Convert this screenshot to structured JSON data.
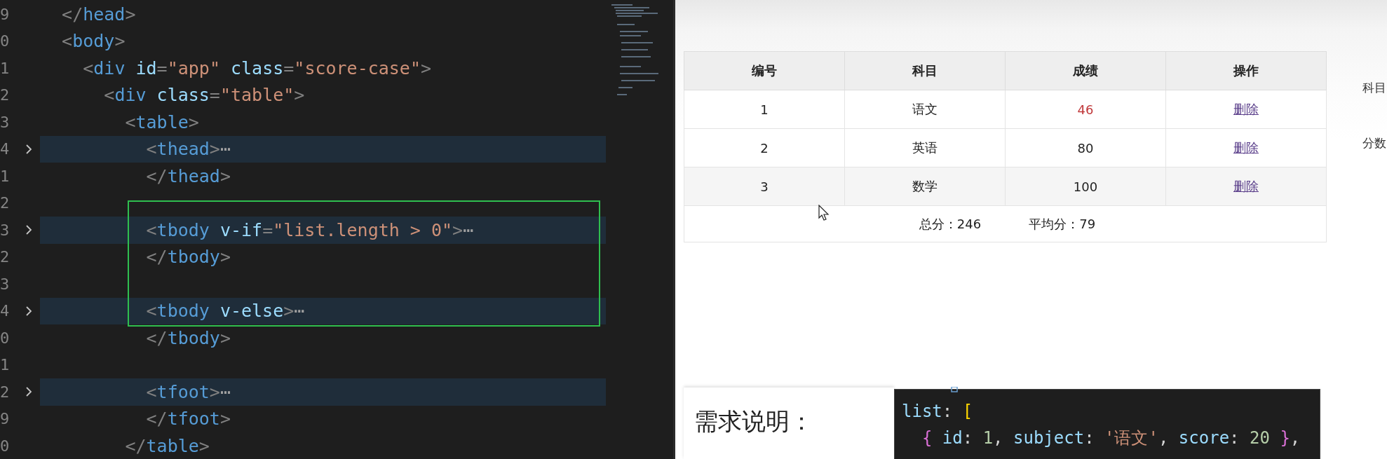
{
  "editor": {
    "lines": [
      {
        "number": "9",
        "text": "  </head>",
        "folded": false
      },
      {
        "number": "0",
        "text": "  <body>",
        "folded": false
      },
      {
        "number": "1",
        "text": "    <div id=\"app\" class=\"score-case\">",
        "folded": false
      },
      {
        "number": "2",
        "text": "      <div class=\"table\">",
        "folded": false
      },
      {
        "number": "3",
        "text": "        <table>",
        "folded": false
      },
      {
        "number": "4",
        "text": "          <thead>⋯",
        "folded": true
      },
      {
        "number": "1",
        "text": "          </thead>",
        "folded": false
      },
      {
        "number": "2",
        "folded": false
      },
      {
        "number": "3",
        "text": "          <tbody v-if=\"list.length > 0\">⋯",
        "folded": true
      },
      {
        "number": "2",
        "text": "          </tbody>",
        "folded": false
      },
      {
        "number": "3",
        "folded": false
      },
      {
        "number": "4",
        "text": "          <tbody v-else>⋯",
        "folded": true
      },
      {
        "number": "0",
        "text": "          </tbody>",
        "folded": false
      },
      {
        "number": "1",
        "folded": false
      },
      {
        "number": "2",
        "text": "          <tfoot>⋯",
        "folded": true
      },
      {
        "number": "9",
        "text": "          </tfoot>",
        "folded": false
      },
      {
        "number": "0",
        "text": "        </table>",
        "folded": false
      }
    ]
  },
  "table": {
    "columns": [
      "编号",
      "科目",
      "成绩",
      "操作"
    ],
    "rows": [
      {
        "id": "1",
        "subject": "语文",
        "score": "46",
        "failing": true,
        "action": "删除"
      },
      {
        "id": "2",
        "subject": "英语",
        "score": "80",
        "failing": false,
        "action": "删除"
      },
      {
        "id": "3",
        "subject": "数学",
        "score": "100",
        "failing": false,
        "action": "删除"
      }
    ],
    "footer": {
      "total": "总分：246",
      "average": "平均分：79"
    }
  },
  "side_labels": [
    "科目",
    "分数"
  ],
  "requirements": {
    "title": "需求说明："
  },
  "code_popup": {
    "lines": [
      "list: [",
      "  { id: 1, subject: '语文', score: 20 },"
    ]
  }
}
